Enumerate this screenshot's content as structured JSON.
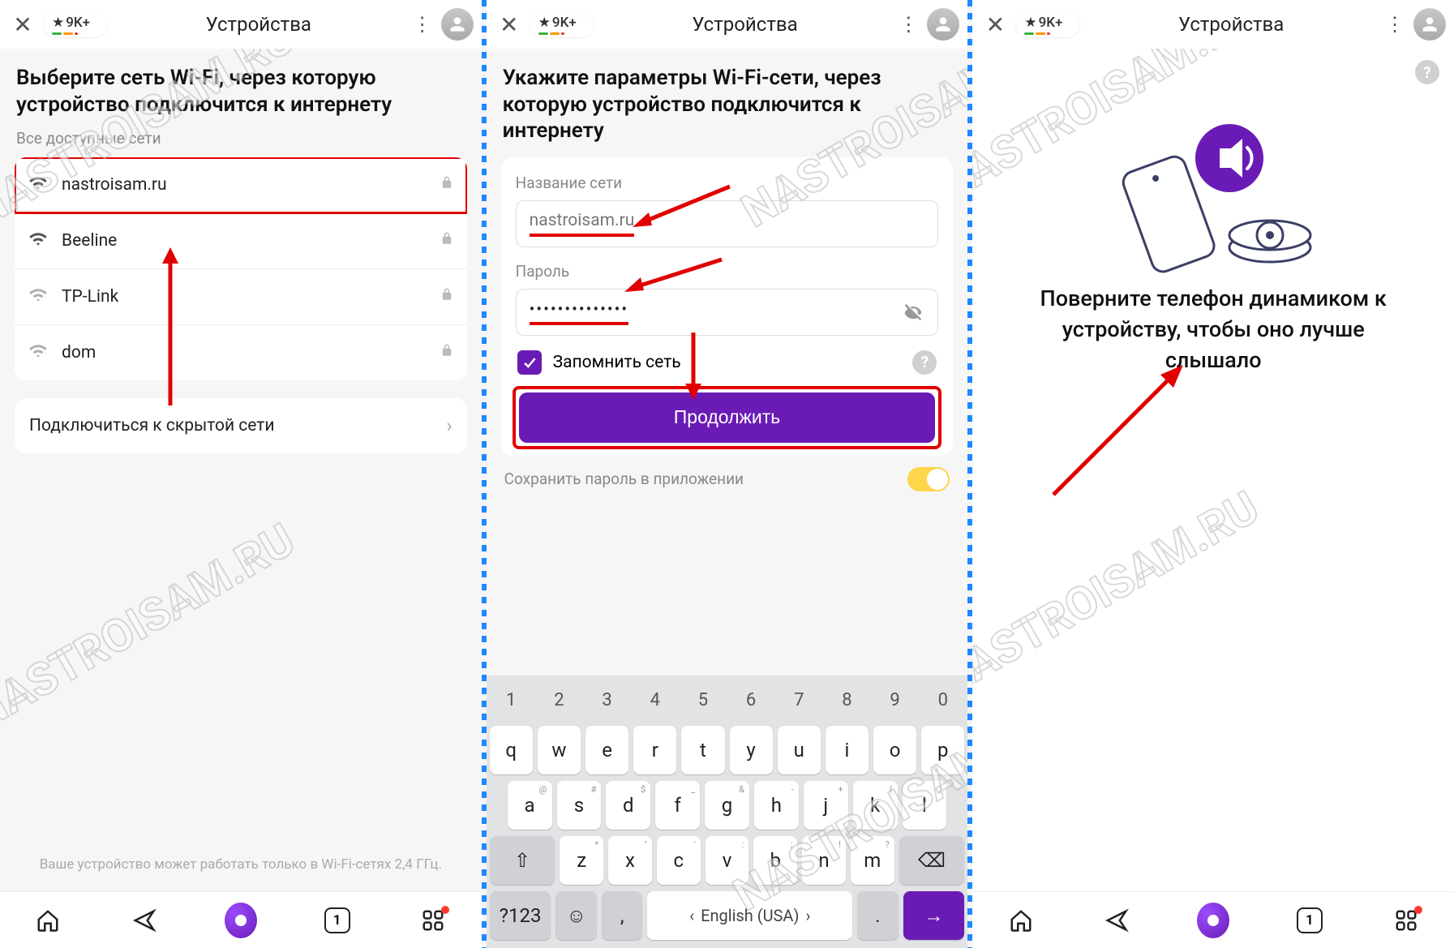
{
  "watermark_text": "NASTROISAM.RU",
  "topbar": {
    "rating": "9K+",
    "title": "Устройства"
  },
  "bottomnav": {
    "tab_count": "1"
  },
  "panel1": {
    "heading": "Выберите сеть Wi-Fi, через которую устройство подключится к интернету",
    "subhead": "Все доступные сети",
    "networks": [
      {
        "name": "nastroisam.ru",
        "locked": true,
        "strong": true,
        "highlight": true
      },
      {
        "name": "Beeline",
        "locked": true,
        "strong": true
      },
      {
        "name": "TP-Link",
        "locked": true,
        "strong": false
      },
      {
        "name": "dom",
        "locked": true,
        "strong": false
      }
    ],
    "hidden_row": "Подключиться к скрытой сети",
    "footnote": "Ваше устройство может работать только в Wi-Fi-сетях 2,4 ГГц."
  },
  "panel2": {
    "heading": "Укажите параметры Wi-Fi-сети, через которую устройство подключится к интернету",
    "name_label": "Название сети",
    "name_value": "nastroisam.ru",
    "password_label": "Пароль",
    "password_masked": "••••••••••••••",
    "remember_label": "Запомнить сеть",
    "continue_label": "Продолжить",
    "save_label": "Сохранить пароль в приложении",
    "keyboard": {
      "nums": [
        "1",
        "2",
        "3",
        "4",
        "5",
        "6",
        "7",
        "8",
        "9",
        "0"
      ],
      "row1": [
        "q",
        "w",
        "e",
        "r",
        "t",
        "y",
        "u",
        "i",
        "o",
        "p"
      ],
      "row2": [
        "a",
        "s",
        "d",
        "f",
        "g",
        "h",
        "j",
        "k",
        "l"
      ],
      "row2_sup": [
        "@",
        "#",
        "$",
        "_",
        "&",
        "-",
        "+",
        "(",
        ")"
      ],
      "row3": [
        "z",
        "x",
        "c",
        "v",
        "b",
        "n",
        "m"
      ],
      "row3_sup": [
        "*",
        "\"",
        "'",
        ":",
        ";",
        "!",
        "?"
      ],
      "sym": "?123",
      "lang_label": "English (USA)"
    }
  },
  "panel3": {
    "instruction": "Поверните телефон динамиком к устройству, чтобы оно лучше слышало"
  }
}
